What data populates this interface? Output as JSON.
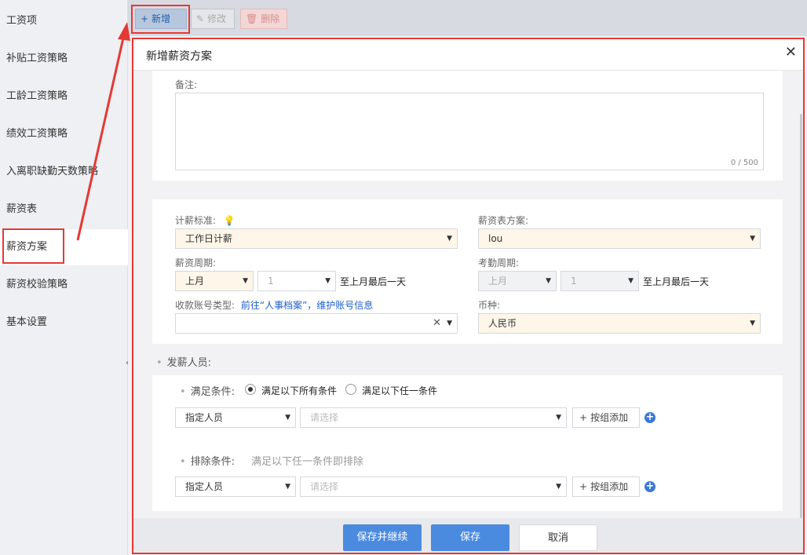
{
  "sidebar": {
    "items": [
      {
        "label": "工资项"
      },
      {
        "label": "补贴工资策略"
      },
      {
        "label": "工龄工资策略"
      },
      {
        "label": "绩效工资策略"
      },
      {
        "label": "入离职缺勤天数策略"
      },
      {
        "label": "薪资表"
      },
      {
        "label": "薪资方案",
        "active": true
      },
      {
        "label": "薪资校验策略"
      },
      {
        "label": "基本设置"
      }
    ]
  },
  "toolbar": {
    "add_label": "新增",
    "edit_label": "修改",
    "delete_label": "删除"
  },
  "dialog": {
    "title": "新增薪资方案",
    "remark": {
      "label": "备注:",
      "counter": "0 / 500"
    },
    "pay_standard": {
      "label": "计薪标准:",
      "value": "工作日计薪"
    },
    "salary_sheet": {
      "label": "薪资表方案:",
      "value": "lou"
    },
    "pay_cycle": {
      "label": "薪资周期:",
      "month": "上月",
      "day": "1",
      "suffix": "至上月最后一天"
    },
    "attendance_cycle": {
      "label": "考勤周期:",
      "month": "上月",
      "day": "1",
      "suffix": "至上月最后一天"
    },
    "account_type": {
      "label": "收款账号类型:",
      "link": "前往“人事档案”，维护账号信息",
      "value": ""
    },
    "currency": {
      "label": "币种:",
      "value": "人民币"
    },
    "payees": {
      "title": "发薪人员:",
      "match": {
        "label": "满足条件:",
        "option_all": "满足以下所有条件",
        "option_any": "满足以下任一条件",
        "selected": "all",
        "type_value": "指定人员",
        "select_placeholder": "请选择",
        "group_add_label": "按组添加"
      },
      "exclude": {
        "label": "排除条件:",
        "hint": "满足以下任一条件即排除",
        "type_value": "指定人员",
        "select_placeholder": "请选择",
        "group_add_label": "按组添加"
      }
    },
    "footer": {
      "save_continue_label": "保存并继续",
      "save_label": "保存",
      "cancel_label": "取消"
    }
  },
  "colors": {
    "primary": "#4a8be0",
    "annotation_red": "#e53935",
    "warm_field": "#fdf6e9"
  }
}
